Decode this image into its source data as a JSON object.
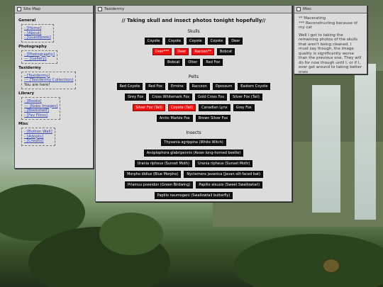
{
  "sitemap": {
    "title": "Site Map",
    "sections": [
      {
        "heading": "General",
        "links": [
          "- [Home]",
          "- [About]",
          "- [Guestbook]"
        ]
      },
      {
        "heading": "Photography",
        "links": [
          "- [Photography]",
          "--- [Gallery]"
        ]
      },
      {
        "heading": "Taxidermy",
        "links": [
          "- [Taxidermy]",
          "--- [Taxidermy Collection]",
          "You are here!"
        ]
      },
      {
        "heading": "Library",
        "links": [
          "- [Books]",
          "--- [Kobo Images]",
          "- [Bookshelf]",
          "- [Fav Films]"
        ]
      },
      {
        "heading": "Misc",
        "links": [
          "- [Button Wall]",
          "- [Adopts]",
          "- [Credits]"
        ]
      }
    ]
  },
  "taxidermy": {
    "title": "Taxidermy",
    "headline": "// Taking skull and insect photos tonight hopefully//",
    "skulls": {
      "heading": "Skulls",
      "rows": [
        [
          {
            "t": "Coyote"
          },
          {
            "t": "Coyote"
          },
          {
            "t": "Coyote"
          },
          {
            "t": "Coyote"
          },
          {
            "t": "Deer"
          }
        ],
        [
          {
            "t": "Deer***",
            "red": true
          },
          {
            "t": "Deer",
            "red": true
          },
          {
            "t": "Racoon**",
            "red": true
          },
          {
            "t": "Bobcat"
          }
        ],
        [
          {
            "t": "Bobcat"
          },
          {
            "t": "Otter"
          },
          {
            "t": "Red Fox"
          }
        ]
      ]
    },
    "pelts": {
      "heading": "Pelts",
      "rows": [
        [
          {
            "t": "Red Coyote"
          },
          {
            "t": "Red Fox"
          },
          {
            "t": "Ermine"
          },
          {
            "t": "Raccoon"
          },
          {
            "t": "Opossum"
          },
          {
            "t": "Eastern Coyote"
          }
        ],
        [
          {
            "t": "Grey Fox"
          },
          {
            "t": "Cross Whitemark Fox"
          },
          {
            "t": "Gold Cross Fox"
          },
          {
            "t": "Silver Fox (Tail)"
          }
        ],
        [
          {
            "t": "Silver Fox (Tail)",
            "red": true
          },
          {
            "t": "Coyote (Tail)",
            "red": true
          },
          {
            "t": "Canadian Lynx"
          },
          {
            "t": "Grey Fox"
          }
        ],
        [
          {
            "t": "Arctic Marble Fox"
          },
          {
            "t": "Brown Silver Fox"
          }
        ]
      ]
    },
    "insects": {
      "heading": "Insects",
      "rows": [
        [
          {
            "t": "Thysania agrippina (White Witch)"
          }
        ],
        [
          {
            "t": "Anoplophora glabripennis (Asian long-horned beetle)"
          }
        ],
        [
          {
            "t": "Urania ripheus (Sunset Moth)"
          },
          {
            "t": "Urania ripheus (Sunset Moth)"
          }
        ],
        [
          {
            "t": "Morpho didius (Blue Morpho)"
          },
          {
            "t": "Nyctemera javanica (Javan silt-faced bat)"
          }
        ],
        [
          {
            "t": "Priamus poseidon (Green Birdwing)"
          },
          {
            "t": "Papilio eleusis (Sweet Swallowtail)"
          }
        ],
        [
          {
            "t": "Papilio neumogeni (Swallowtail butterfly)"
          }
        ]
      ]
    }
  },
  "misc": {
    "title": "Misc",
    "paragraphs": [
      "** Macerating\n*** Reconstructing because of my cat",
      "Well I got to taking the remaining photos of the skulls that aren't being cleaned. I must say though, the image quality is significantly worse than the previous one. They will do for now though until I, or if I, ever get around to taking better ones"
    ]
  }
}
